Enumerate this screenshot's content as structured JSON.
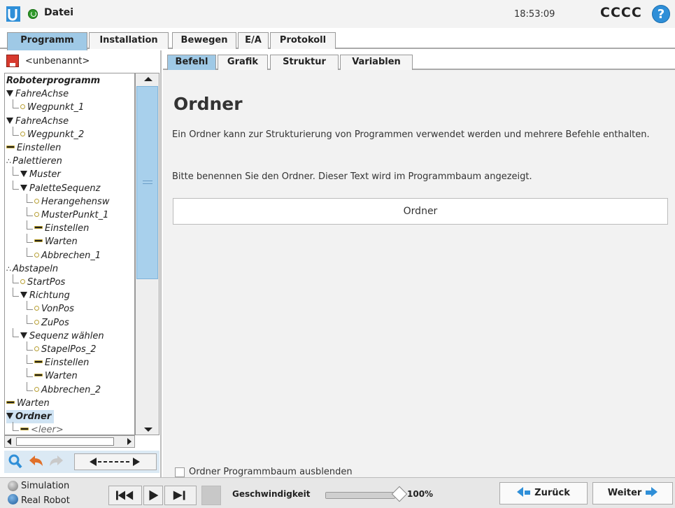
{
  "titlebar": {
    "file_menu": "Datei",
    "clock": "18:53:09",
    "robot_name": "CCCC",
    "help_icon": "?"
  },
  "main_tabs": [
    "Programm",
    "Installation",
    "Bewegen",
    "E/A",
    "Protokoll"
  ],
  "program": {
    "name": "<unbenannt>"
  },
  "tree": [
    {
      "label": "Roboterprogramm",
      "level": 0,
      "icon": "none",
      "bold": true
    },
    {
      "label": "FahreAchse",
      "level": 0,
      "icon": "triangle"
    },
    {
      "label": "Wegpunkt_1",
      "level": 1,
      "icon": "dot"
    },
    {
      "label": "FahreAchse",
      "level": 0,
      "icon": "triangle"
    },
    {
      "label": "Wegpunkt_2",
      "level": 1,
      "icon": "dot"
    },
    {
      "label": "Einstellen",
      "level": 0,
      "icon": "dash"
    },
    {
      "label": "Palettieren",
      "level": 0,
      "icon": "pallet"
    },
    {
      "label": "Muster",
      "level": 1,
      "icon": "triangle"
    },
    {
      "label": "PaletteSequenz",
      "level": 1,
      "icon": "triangle"
    },
    {
      "label": "Herangehensw",
      "level": 2,
      "icon": "dot"
    },
    {
      "label": "MusterPunkt_1",
      "level": 2,
      "icon": "dot"
    },
    {
      "label": "Einstellen",
      "level": 2,
      "icon": "dash"
    },
    {
      "label": "Warten",
      "level": 2,
      "icon": "dash"
    },
    {
      "label": "Abbrechen_1",
      "level": 2,
      "icon": "dot"
    },
    {
      "label": "Abstapeln",
      "level": 0,
      "icon": "pallet"
    },
    {
      "label": "StartPos",
      "level": 1,
      "icon": "dot"
    },
    {
      "label": "Richtung",
      "level": 1,
      "icon": "triangle"
    },
    {
      "label": "VonPos",
      "level": 2,
      "icon": "dot"
    },
    {
      "label": "ZuPos",
      "level": 2,
      "icon": "dot"
    },
    {
      "label": "Sequenz wählen",
      "level": 1,
      "icon": "triangle"
    },
    {
      "label": "StapelPos_2",
      "level": 2,
      "icon": "dot"
    },
    {
      "label": "Einstellen",
      "level": 2,
      "icon": "dash"
    },
    {
      "label": "Warten",
      "level": 2,
      "icon": "dash"
    },
    {
      "label": "Abbrechen_2",
      "level": 2,
      "icon": "dot"
    },
    {
      "label": "Warten",
      "level": 0,
      "icon": "dash"
    },
    {
      "label": "Ordner",
      "level": 0,
      "icon": "triangle",
      "bold": true,
      "selected": true
    },
    {
      "label": "<leer>",
      "level": 1,
      "icon": "dash"
    }
  ],
  "sub_tabs": [
    "Befehl",
    "Grafik",
    "Struktur",
    "Variablen"
  ],
  "content": {
    "heading": "Ordner",
    "description": "Ein Ordner kann zur Strukturierung von Programmen verwendet werden und mehrere Befehle enthalten.",
    "instruction": "Bitte benennen Sie den Ordner. Dieser Text wird im Programmbaum angezeigt.",
    "folder_name": "Ordner",
    "hide_tree_label": "Ordner Programmbaum ausblenden"
  },
  "footer": {
    "simulation": "Simulation",
    "real_robot": "Real Robot",
    "speed_label": "Geschwindigkeit",
    "speed_value": "100%",
    "speed_fraction": 1.0,
    "back": "Zurück",
    "next": "Weiter"
  },
  "colors": {
    "active_tab": "#9fc9e6",
    "accent": "#2f8fd8",
    "power": "#2f9a2a"
  }
}
